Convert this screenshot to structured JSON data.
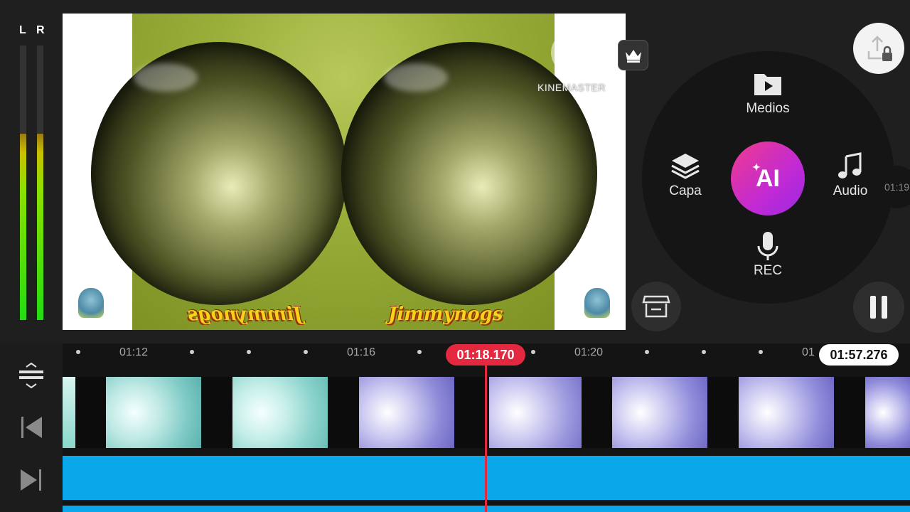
{
  "meters": {
    "left_label": "L",
    "right_label": "R",
    "left_level": 0.68,
    "right_level": 0.68
  },
  "preview": {
    "video_text": "Jimmynogs",
    "watermark_logo": "K",
    "watermark_text": "KINEMASTER"
  },
  "wheel": {
    "media_label": "Medios",
    "layer_label": "Capa",
    "ai_label": "AI",
    "audio_label": "Audio",
    "rec_label": "REC",
    "peek_label": "01:19"
  },
  "timeline": {
    "ticks": [
      "01:12",
      "01:16",
      "01:20",
      "01"
    ],
    "playhead_time": "01:18.170",
    "total_duration": "01:57.276"
  },
  "colors": {
    "playhead": "#e4283f",
    "audio_track": "#0aa7ea",
    "ai_gradient_start": "#f03b8d",
    "ai_gradient_end": "#9a2be0"
  },
  "icons": {
    "export": "export-lock-icon",
    "crown": "crown-icon",
    "store": "asset-store-icon",
    "pause": "pause-icon",
    "media": "media-folder-icon",
    "layer": "layers-icon",
    "audio": "music-note-icon",
    "rec": "microphone-icon",
    "expand": "expand-timeline-icon",
    "jump_start": "jump-to-start-icon",
    "jump_end": "jump-to-end-icon"
  }
}
